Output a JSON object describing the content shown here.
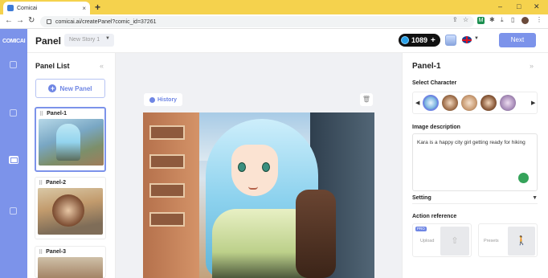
{
  "browser": {
    "tab_title": "Comicai",
    "url": "comicai.ai/createPanel?comic_id=37261",
    "new_tab_symbol": "+",
    "tab_close_symbol": "×"
  },
  "header": {
    "title": "Panel",
    "story_select_value": "New Story 1",
    "credits": "1089",
    "credits_plus": "+",
    "next_label": "Next"
  },
  "rail": {
    "logo": "COMICAI",
    "icons": [
      "home-icon",
      "character-icon",
      "panel-icon",
      "book-icon"
    ]
  },
  "panel_list": {
    "title": "Panel List",
    "collapse_symbol": "«",
    "new_panel_label": "New Panel",
    "new_panel_icon": "+",
    "items": [
      {
        "label": "Panel-1",
        "selected": true
      },
      {
        "label": "Panel-2",
        "selected": false
      },
      {
        "label": "Panel-3",
        "selected": false
      }
    ]
  },
  "canvas": {
    "history_label": "History",
    "trash_icon": "trash-icon"
  },
  "right_panel": {
    "title": "Panel-1",
    "collapse_symbol": "»",
    "select_character_label": "Select Character",
    "characters": [
      "character-1",
      "character-2",
      "character-3",
      "character-4",
      "character-5"
    ],
    "image_description_label": "Image description",
    "image_description_value": "Kara is a happy city girl getting ready for hiking",
    "setting_label": "Setting",
    "action_reference_label": "Action reference",
    "pro_badge": "PRO",
    "upload_label": "Upload",
    "presets_label": "Presets"
  },
  "colors": {
    "accent": "#7c93ea",
    "tabstrip": "#f5d24d"
  }
}
